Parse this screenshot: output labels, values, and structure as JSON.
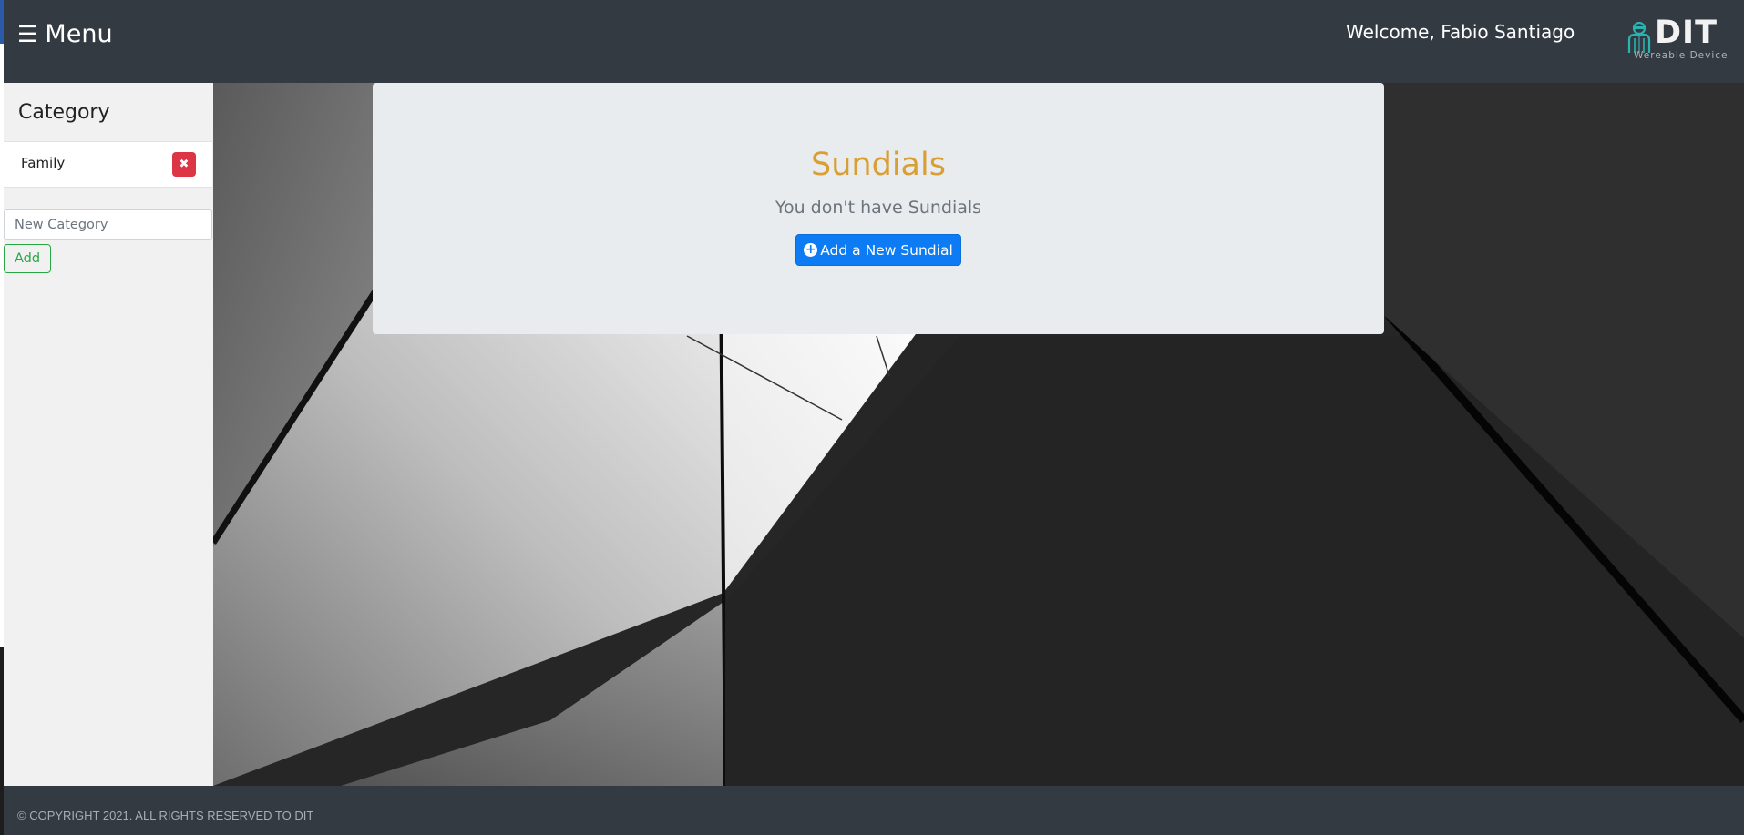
{
  "header": {
    "menu_icon": "hamburger-icon",
    "menu_label": "Menu",
    "welcome": "Welcome, Fabio Santiago",
    "logo": {
      "word": "DIT",
      "tagline": "Wereable Device"
    }
  },
  "sidebar": {
    "title": "Category",
    "categories": [
      {
        "label": "Family",
        "delete_icon": "close-icon"
      }
    ],
    "new_category_placeholder": "New Category",
    "add_label": "Add"
  },
  "main": {
    "title": "Sundials",
    "empty_message": "You don't have Sundials",
    "add_button_label": "Add a New Sundial",
    "add_button_icon": "plus-circle-icon"
  },
  "footer": {
    "copyright": "© COPYRIGHT 2021. ALL RIGHTS RESERVED TO DIT"
  },
  "colors": {
    "header_bg": "#343a42",
    "title_accent": "#d99f33",
    "primary": "#0d7cf4",
    "danger": "#dc3545",
    "success": "#28a745"
  }
}
